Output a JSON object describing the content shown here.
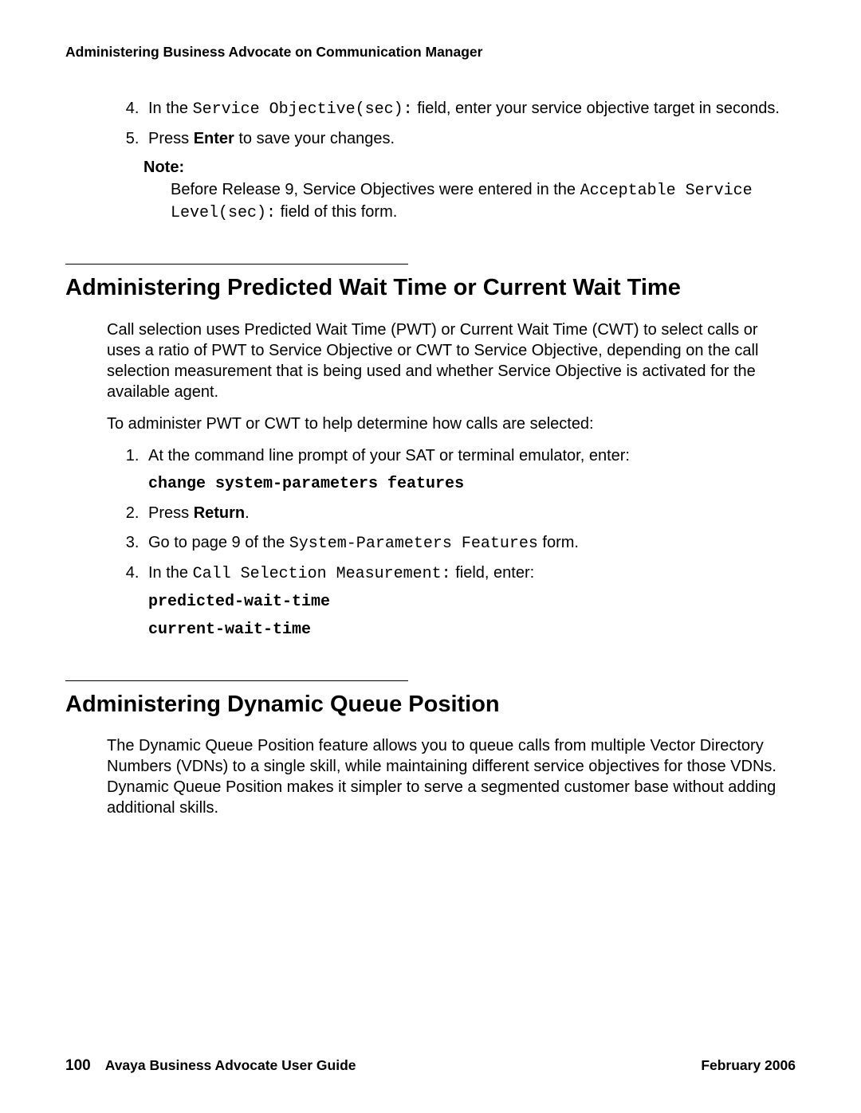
{
  "header": {
    "running_head": "Administering Business Advocate on Communication Manager"
  },
  "intro_steps": {
    "start": 4,
    "items": [
      {
        "prefix": "In the ",
        "mono": "Service Objective(sec):",
        "suffix": " field, enter your service objective target in seconds."
      },
      {
        "text_before_bold": "Press ",
        "bold": "Enter",
        "text_after_bold": " to save your changes."
      }
    ]
  },
  "note": {
    "label": "Note:",
    "body_before_mono": "Before Release 9, Service Objectives were entered in the ",
    "mono": "Acceptable Service Level(sec):",
    "body_after_mono": " field of this form."
  },
  "section1": {
    "title": "Administering Predicted Wait Time or Current Wait Time",
    "para1": "Call selection uses Predicted Wait Time (PWT) or Current Wait Time (CWT) to select calls or uses a ratio of PWT to Service Objective or CWT to Service Objective, depending on the call selection measurement that is being used and whether Service Objective is activated for the available agent.",
    "para2": "To administer PWT or CWT to help determine how calls are selected:",
    "steps": [
      {
        "text": "At the command line prompt of your SAT or terminal emulator, enter:",
        "cmd": "change system-parameters features"
      },
      {
        "text_before_bold": "Press ",
        "bold": "Return",
        "text_after_bold": "."
      },
      {
        "prefix": "Go to page 9 of the ",
        "mono": "System-Parameters Features",
        "suffix": " form."
      },
      {
        "prefix": "In the ",
        "mono": "Call Selection Measurement:",
        "suffix": " field, enter:",
        "cmd_lines": [
          "predicted-wait-time",
          "current-wait-time"
        ]
      }
    ]
  },
  "section2": {
    "title": "Administering Dynamic Queue Position",
    "para1": "The Dynamic Queue Position feature allows you to queue calls from multiple Vector Directory Numbers (VDNs) to a single skill, while maintaining different service objectives for those VDNs. Dynamic Queue Position makes it simpler to serve a segmented customer base without adding additional skills."
  },
  "footer": {
    "page_number": "100",
    "guide_title": "Avaya Business Advocate User Guide",
    "date": "February 2006"
  }
}
